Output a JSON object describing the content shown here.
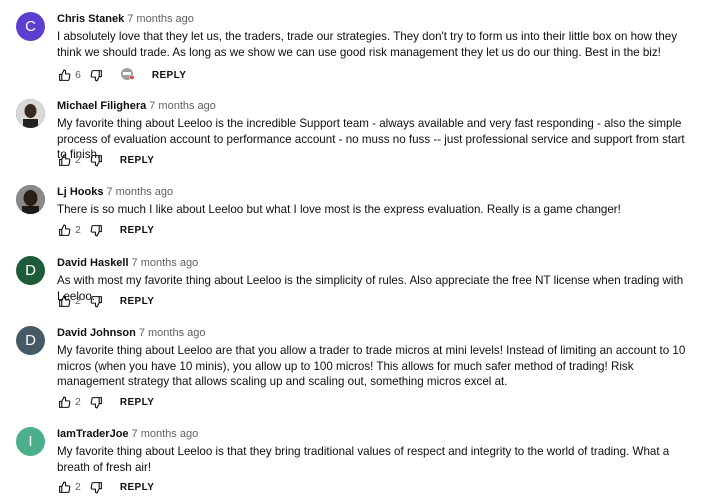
{
  "comments": [
    {
      "author": "Chris Stanek",
      "time": "7 months ago",
      "avatar_letter": "C",
      "avatar_color": "#5b3fd1",
      "text": "I absolutely love that they let us, the traders, trade our strategies. They don't try to form us into their little box on how they think we should trade. As long as we show we can use good risk management they let us do our thing. Best in the biz!",
      "likes": "6",
      "hearted": true,
      "reply_label": "REPLY"
    },
    {
      "author": "Michael Filighera",
      "time": "7 months ago",
      "avatar_letter": "",
      "avatar_color": "#3a3a3a",
      "text": "My favorite thing about Leeloo is the incredible Support team - always available and very fast responding - also the simple process of evaluation account to performance account  - no muss no fuss -- just professional service and support from start to finish.",
      "likes": "2",
      "hearted": false,
      "reply_label": "REPLY"
    },
    {
      "author": "Lj Hooks",
      "time": "7 months ago",
      "avatar_letter": "",
      "avatar_color": "#2b2b2b",
      "text": "There is so much I like about Leeloo but what I love most is the express evaluation. Really is a game changer!",
      "likes": "2",
      "hearted": false,
      "reply_label": "REPLY"
    },
    {
      "author": "David Haskell",
      "time": "7 months ago",
      "avatar_letter": "D",
      "avatar_color": "#1f5a3a",
      "text": "As with most my favorite thing about Leeloo is the simplicity of rules.  Also appreciate the free NT license when trading with Leeloo.",
      "likes": "2",
      "hearted": false,
      "reply_label": "REPLY"
    },
    {
      "author": "David Johnson",
      "time": "7 months ago",
      "avatar_letter": "D",
      "avatar_color": "#455a64",
      "text": "My favorite thing about Leeloo are that you allow a trader to trade micros at mini levels! Instead of limiting an account to 10 micros (when you have 10 minis), you allow up to 100 micros! This allows for much safer method of trading! Risk management strategy that allows scaling up and scaling out, something micros excel at.",
      "likes": "2",
      "hearted": false,
      "reply_label": "REPLY"
    },
    {
      "author": "IamTraderJoe",
      "time": "7 months ago",
      "avatar_letter": "I",
      "avatar_color": "#4caf8a",
      "text": "My favorite thing about Leeloo is that they bring traditional values of respect and integrity to the world of trading. What a breath of fresh air!",
      "likes": "2",
      "hearted": false,
      "reply_label": "REPLY"
    }
  ]
}
